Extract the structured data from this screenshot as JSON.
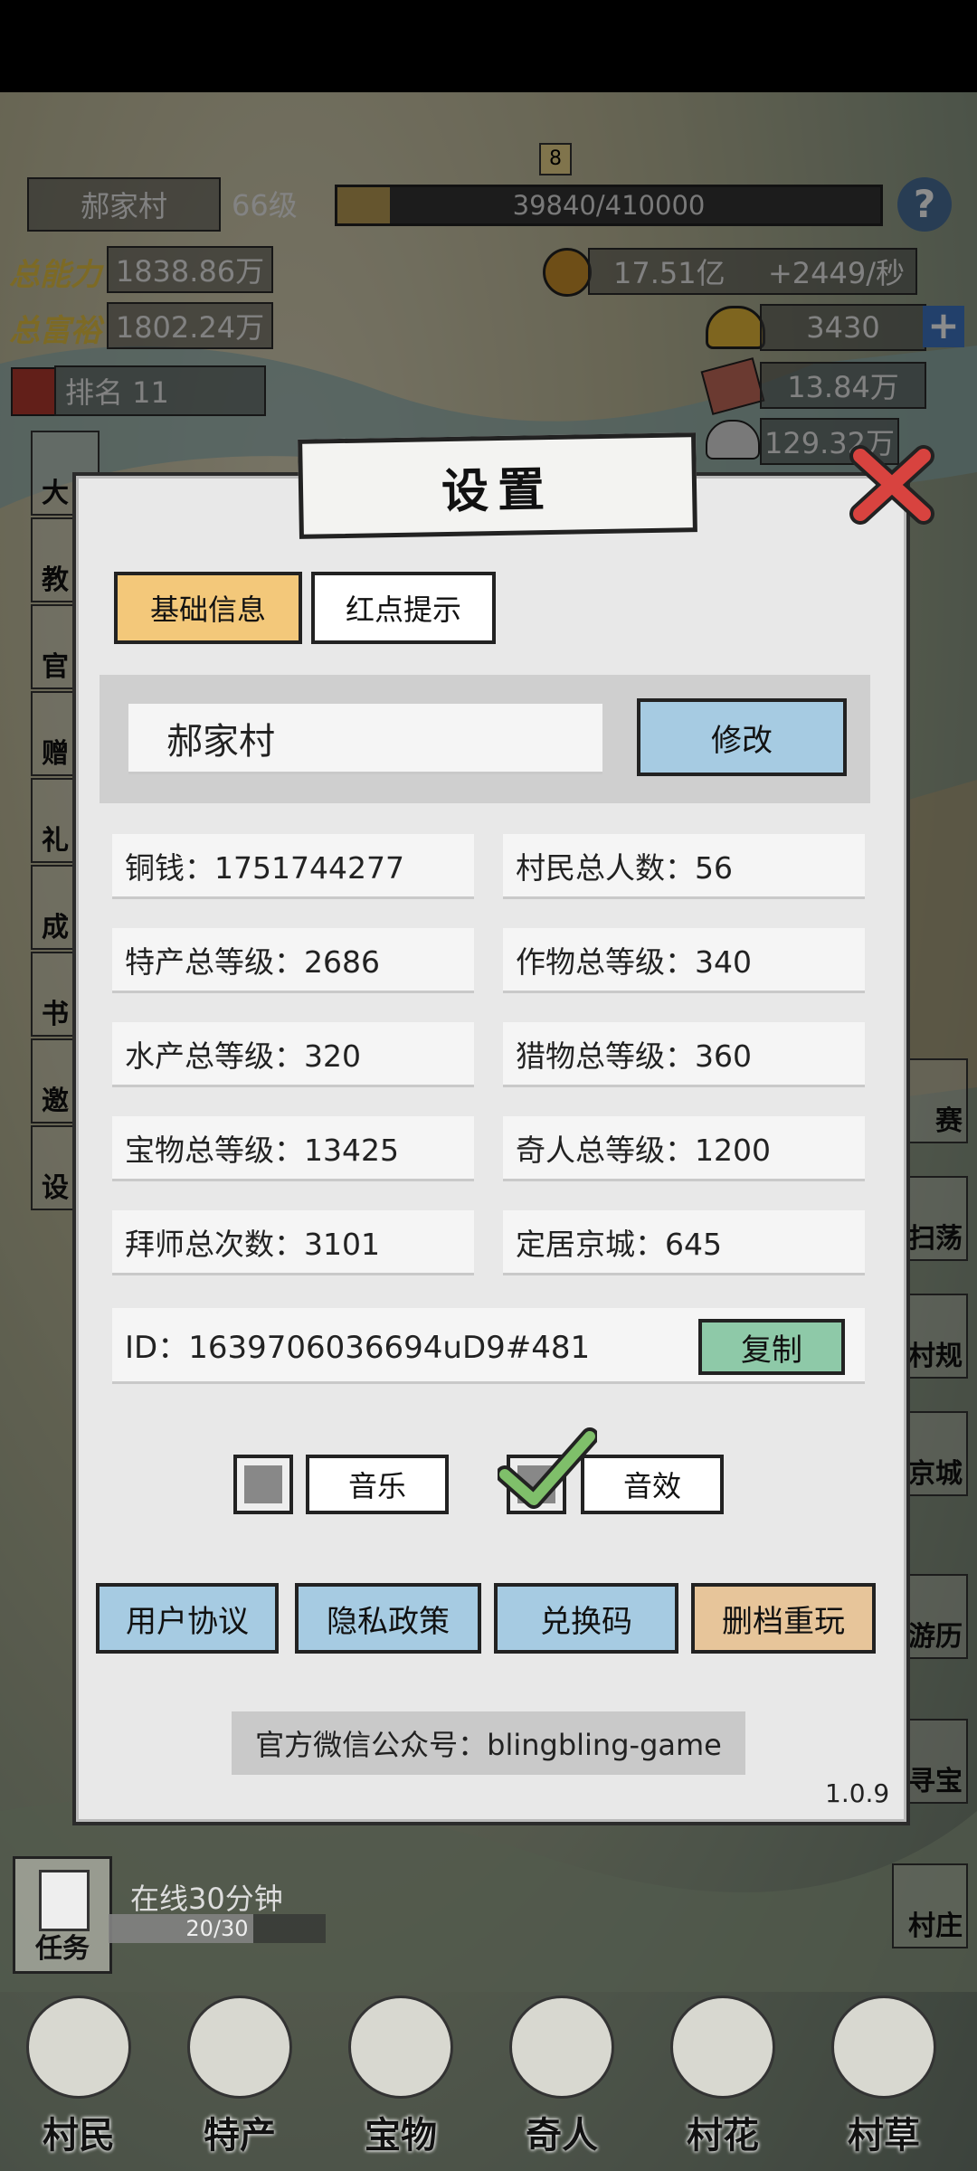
{
  "hud": {
    "village_name": "郝家村",
    "level": "66级",
    "exp": "39840/410000",
    "exp_fraction": 0.097,
    "help_icon": "question-icon",
    "total_power_label": "总能力",
    "total_power": "1838.86万",
    "total_wealth_label": "总富裕",
    "total_wealth": "1802.24万",
    "rank": "排名 11",
    "copper": "17.51亿",
    "copper_rate": "+2449/秒",
    "gold": "3430",
    "plus_icon": "plus-icon",
    "stat3": "13.84万",
    "stat4": "129.32万",
    "map_badge": "8"
  },
  "dialog": {
    "title": "设置",
    "close_icon": "close-icon",
    "tabs": [
      "基础信息",
      "红点提示"
    ],
    "name_value": "郝家村",
    "modify_label": "修改",
    "stats": [
      "铜钱：1751744277",
      "村民总人数：56",
      "特产总等级：2686",
      "作物总等级：340",
      "水产总等级：320",
      "猎物总等级：360",
      "宝物总等级：13425",
      "奇人总等级：1200",
      "拜师总次数：3101",
      "定居京城：645"
    ],
    "id_text": "ID：1639706036694uD9#481",
    "copy_label": "复制",
    "music_label": "音乐",
    "sound_label": "音效",
    "music_checked": false,
    "sound_checked": true,
    "buttons": [
      "用户协议",
      "隐私政策",
      "兑换码",
      "删档重玩"
    ],
    "wechat": "官方微信公众号：blingbling-game",
    "version": "1.0.9"
  },
  "task": {
    "label": "任务",
    "title": "在线30分钟",
    "progress": "20/30",
    "fraction": 0.667
  },
  "side_right": [
    "赛",
    "扫荡",
    "村规",
    "京城",
    "游历",
    "寻宝",
    "村庄"
  ],
  "side_left": [
    "大",
    "教",
    "官",
    "赠",
    "礼",
    "成",
    "书",
    "邀",
    "设"
  ],
  "bottom_tabs": [
    "村民",
    "特产",
    "宝物",
    "奇人",
    "村花",
    "村草"
  ],
  "colors": {
    "tab_active": "#f3c87a",
    "btn_blue": "#a6cbe2",
    "btn_green": "#8ec9a8",
    "btn_tan": "#e7c59a",
    "close_red": "#d8433f"
  }
}
